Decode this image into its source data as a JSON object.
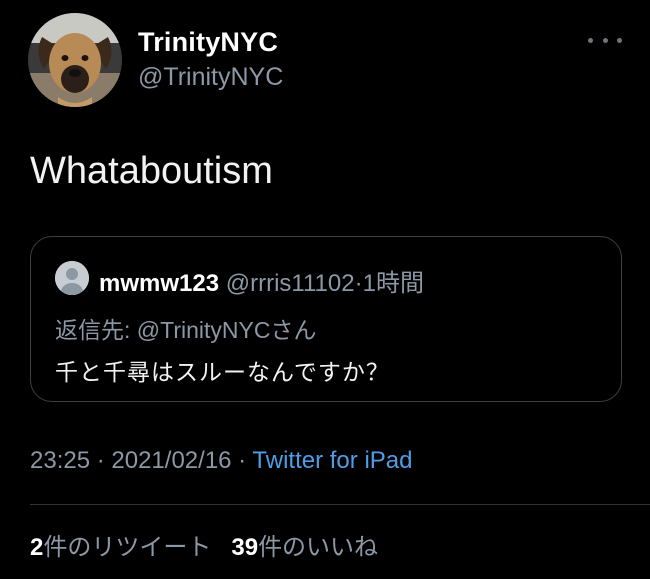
{
  "tweet": {
    "author_name": "TrinityNYC",
    "author_handle": "@TrinityNYC",
    "text": "Whataboutism",
    "more_icon": "more-horizontal-icon"
  },
  "quote": {
    "name": "mwmw123",
    "handle": "@rrris11102",
    "separator": "·",
    "time": "1時間",
    "reply_to": "返信先: @TrinityNYCさん",
    "text": "千と千尋はスルーなんですか？",
    "avatar_icon": "default-profile-icon"
  },
  "meta": {
    "time": "23:25",
    "separator1": " · ",
    "date": "2021/02/16",
    "separator2": " · ",
    "source": "Twitter for iPad"
  },
  "stats": {
    "retweet_count": "2",
    "retweet_label": "件のリツイート",
    "like_count": "39",
    "like_label": "件のいいね"
  },
  "colors": {
    "background": "#000000",
    "text_primary": "#ffffff",
    "text_secondary": "#8b98a5",
    "link": "#4d9ee6",
    "border": "#3a3f44"
  }
}
